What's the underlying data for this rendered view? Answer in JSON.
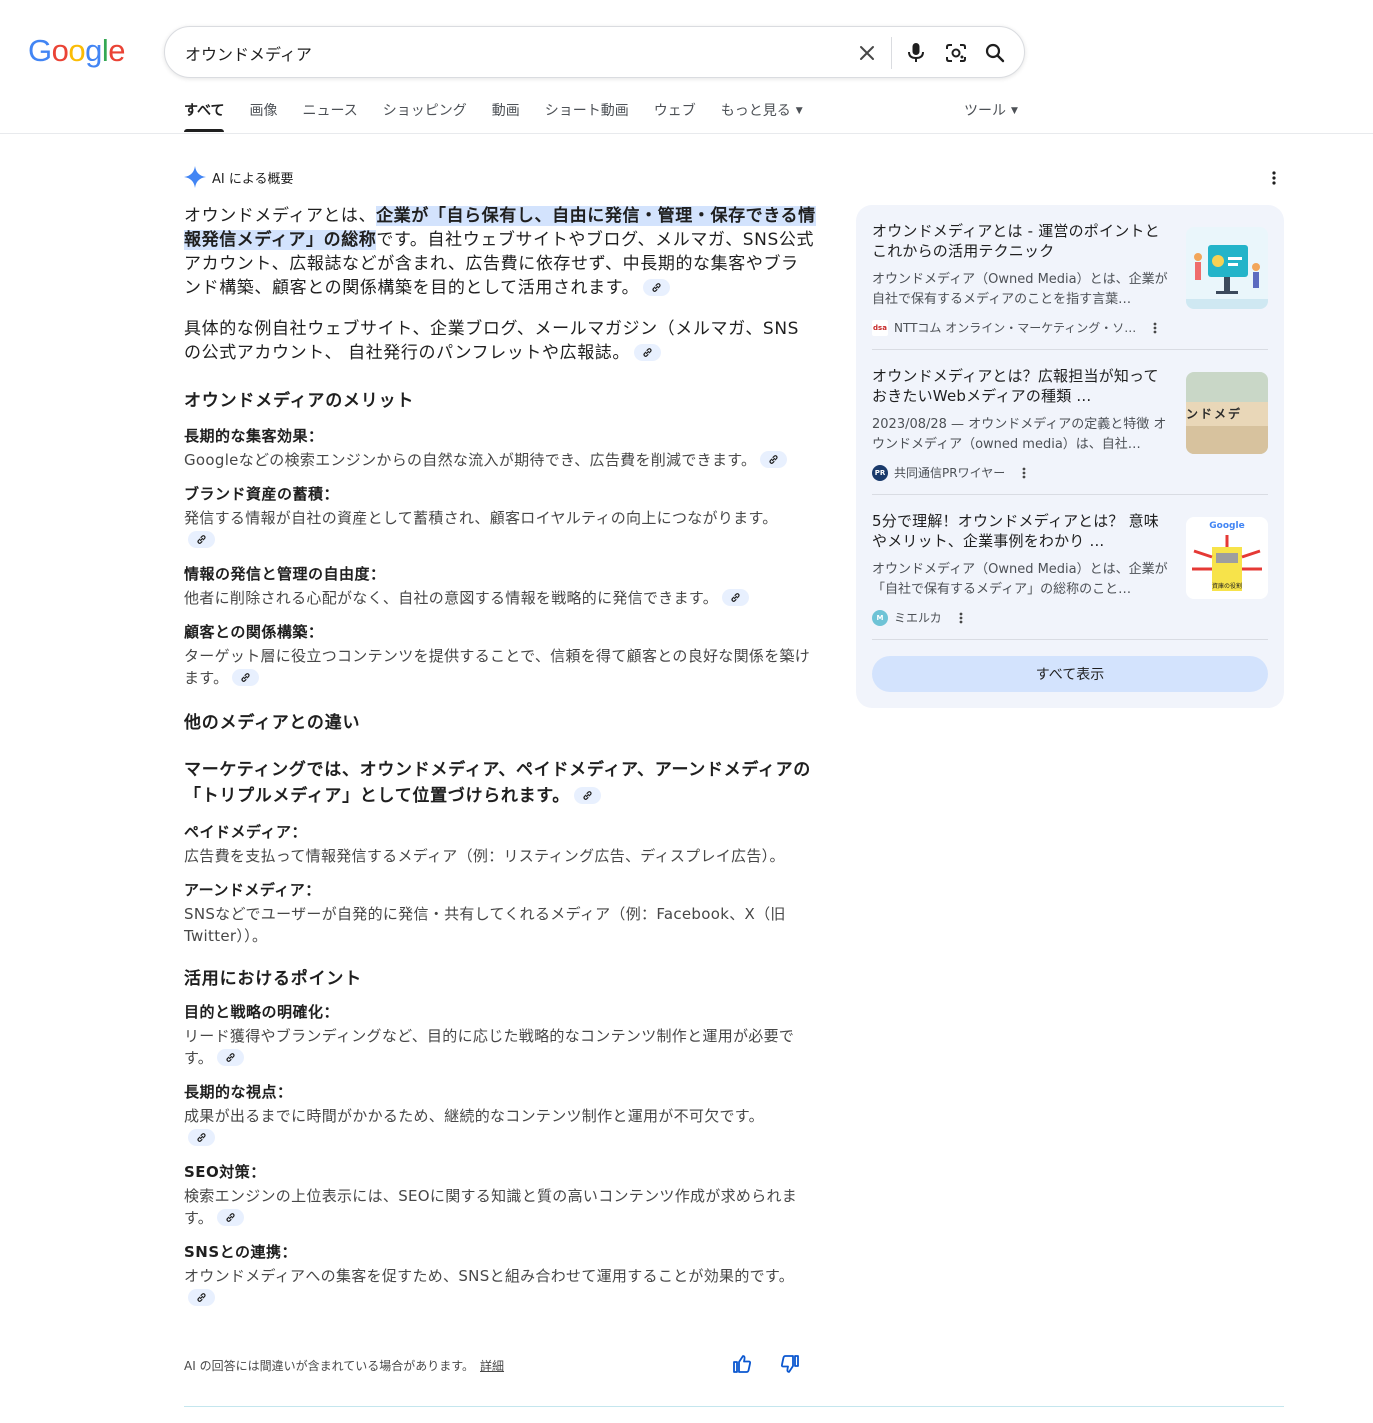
{
  "logo": {
    "text": "Google"
  },
  "search": {
    "query": "オウンドメディア"
  },
  "tabs": [
    {
      "label": "すべて"
    },
    {
      "label": "画像"
    },
    {
      "label": "ニュース"
    },
    {
      "label": "ショッピング"
    },
    {
      "label": "動画"
    },
    {
      "label": "ショート動画"
    },
    {
      "label": "ウェブ"
    },
    {
      "label": "もっと見る"
    }
  ],
  "tools_label": "ツール",
  "ai": {
    "header": "AI による概要",
    "lead_before": "オウンドメディアとは、",
    "lead_highlight": "企業が「自ら保有し、自由に発信・管理・保存できる情報発信メディア」の総称",
    "lead_after": "です。自社ウェブサイトやブログ、メルマガ、SNS公式アカウント、広報誌などが含まれ、広告費に依存せず、中長期的な集客やブランド構築、顧客との関係構築を目的として活用されます。",
    "examples": "具体的な例自社ウェブサイト、企業ブログ、メールマガジン（メルマガ、SNSの公式アカウント、 自社発行のパンフレットや広報誌。",
    "merit_heading": "オウンドメディアのメリット",
    "merits": [
      {
        "title": "長期的な集客効果：",
        "text": "Googleなどの検索エンジンからの自然な流入が期待でき、広告費を削減できます。"
      },
      {
        "title": "ブランド資産の蓄積：",
        "text": "発信する情報が自社の資産として蓄積され、顧客ロイヤルティの向上につながります。"
      },
      {
        "title": "情報の発信と管理の自由度：",
        "text": "他者に削除される心配がなく、自社の意図する情報を戦略的に発信できます。"
      },
      {
        "title": "顧客との関係構築：",
        "text": "ターゲット層に役立つコンテンツを提供することで、信頼を得て顧客との良好な関係を築けます。"
      }
    ],
    "diff_heading": "他のメディアとの違い",
    "marketing": "マーケティングでは、オウンドメディア、ペイドメディア、アーンドメディアの「トリプルメディア」として位置づけられます。",
    "media_types": [
      {
        "title": "ペイドメディア：",
        "text": "広告費を支払って情報発信するメディア（例：リスティング広告、ディスプレイ広告）。"
      },
      {
        "title": "アーンドメディア：",
        "text": "SNSなどでユーザーが自発的に発信・共有してくれるメディア（例：Facebook、X（旧Twitter））。"
      }
    ],
    "points_heading": "活用におけるポイント",
    "points": [
      {
        "title": "目的と戦略の明確化：",
        "text": "リード獲得やブランディングなど、目的に応じた戦略的なコンテンツ制作と運用が必要です。"
      },
      {
        "title": "長期的な視点：",
        "text": "成果が出るまでに時間がかかるため、継続的なコンテンツ制作と運用が不可欠です。"
      },
      {
        "title": "SEO対策：",
        "text": "検索エンジンの上位表示には、SEOに関する知識と質の高いコンテンツ作成が求められます。"
      },
      {
        "title": "SNSとの連携：",
        "text": "オウンドメディアへの集客を促すため、SNSと組み合わせて運用することが効果的です。"
      }
    ],
    "disclaimer": "AI の回答には間違いが含まれている場合があります。",
    "disclaimer_link": "詳細"
  },
  "sources": [
    {
      "title": "オウンドメディアとは - 運営のポイントとこれからの活用テクニック",
      "snippet": "オウンドメディア（Owned Media）とは、企業が自社で保有するメディアのことを指す言葉…",
      "source": "NTTコム オンライン・マーケティング・ソ…",
      "favicon_text": "dsa"
    },
    {
      "title": "オウンドメディアとは？広報担当が知っておきたいWebメディアの種類 ...",
      "snippet": "2023/08/28 — オウンドメディアの定義と特徴 オウンドメディア（owned media）は、自社…",
      "source": "共同通信PRワイヤー",
      "favicon_text": "PR",
      "thumb_text": "ンドメデ"
    },
    {
      "title": "5分で理解！オウンドメディアとは？ 意味やメリット、企業事例をわかり ...",
      "snippet": "オウンドメディア（Owned Media）とは、企業が「自社で保有するメディア」の総称のこと…",
      "source": "ミエルカ",
      "favicon_text": "M",
      "thumb_logo": "Google",
      "thumb_caption": "資庫の役割"
    }
  ],
  "show_all": "すべて表示",
  "colors": {
    "accent": "#0b57d0",
    "highlight": "#d3e3fd",
    "panel": "#f1f4fb"
  }
}
